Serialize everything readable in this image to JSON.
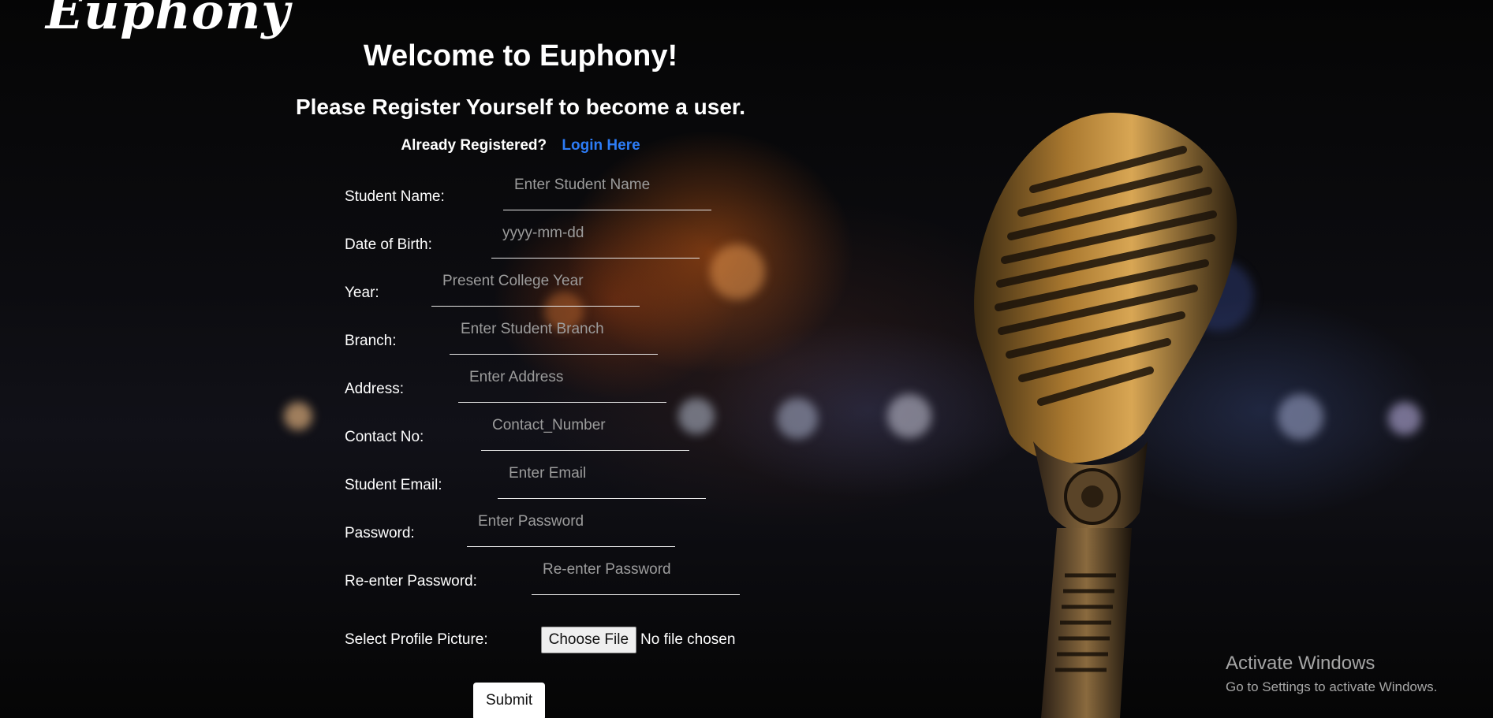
{
  "brand": {
    "logo_text": "Euphony"
  },
  "header": {
    "welcome": "Welcome to Euphony!",
    "subtitle": "Please Register Yourself to become a user."
  },
  "login_prompt": {
    "text": "Already Registered?",
    "link_label": "Login Here"
  },
  "form": {
    "fields": [
      {
        "label": "Student Name:",
        "placeholder": "Enter Student Name"
      },
      {
        "label": "Date of Birth:",
        "placeholder": "yyyy-mm-dd"
      },
      {
        "label": "Year:",
        "placeholder": "Present College Year"
      },
      {
        "label": "Branch:",
        "placeholder": "Enter Student Branch"
      },
      {
        "label": "Address:",
        "placeholder": "Enter Address"
      },
      {
        "label": "Contact No:",
        "placeholder": "Contact_Number"
      },
      {
        "label": "Student Email:",
        "placeholder": "Enter Email"
      },
      {
        "label": "Password:",
        "placeholder": "Enter Password"
      },
      {
        "label": "Re-enter Password:",
        "placeholder": "Re-enter Password"
      }
    ],
    "profile_picture": {
      "label": "Select Profile Picture:",
      "button_label": "Choose File",
      "status": "No file chosen"
    },
    "submit_label": "Submit"
  },
  "windows_watermark": {
    "title": "Activate Windows",
    "subtitle": "Go to Settings to activate Windows."
  },
  "colors": {
    "link": "#2d7cf6",
    "text": "#ffffff",
    "placeholder": "#9c9c9c"
  }
}
